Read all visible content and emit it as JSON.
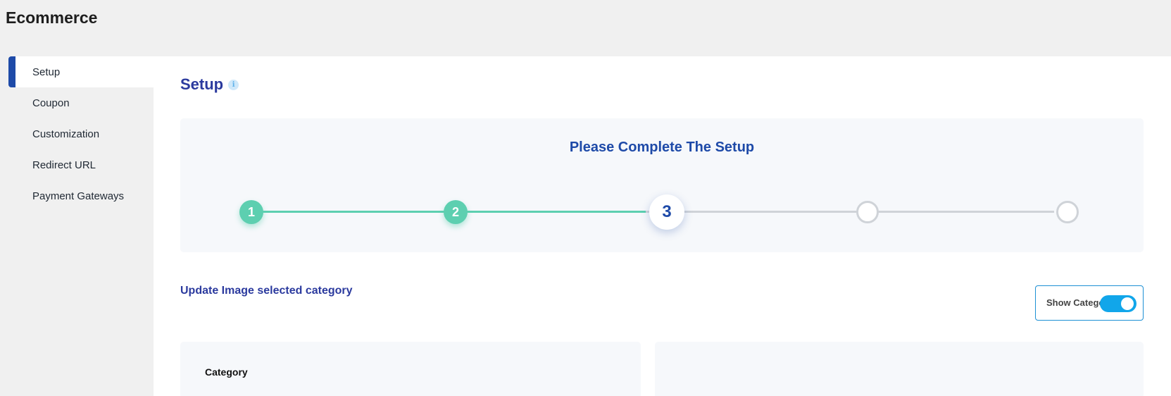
{
  "app": {
    "title": "Ecommerce"
  },
  "sidebar": {
    "items": [
      {
        "label": "Setup",
        "active": true
      },
      {
        "label": "Coupon"
      },
      {
        "label": "Customization"
      },
      {
        "label": "Redirect URL"
      },
      {
        "label": "Payment Gateways"
      }
    ]
  },
  "main": {
    "title": "Setup",
    "info_icon": "info-icon",
    "stepper": {
      "title": "Please Complete The Setup",
      "current_step": 3,
      "total_steps": 5,
      "steps": [
        {
          "label": "1",
          "state": "done"
        },
        {
          "label": "2",
          "state": "done"
        },
        {
          "label": "3",
          "state": "current"
        },
        {
          "label": "",
          "state": "todo"
        },
        {
          "label": "",
          "state": "todo"
        }
      ]
    },
    "section_label": "Update Image selected category",
    "toggle": {
      "label": "Show Catego",
      "on": true
    },
    "category_panel": {
      "title": "Category"
    }
  },
  "colors": {
    "accent": "#1e4aa8",
    "heading": "#2b3a9e",
    "step_done": "#5dcfb0",
    "toggle_on": "#11a6ea"
  }
}
